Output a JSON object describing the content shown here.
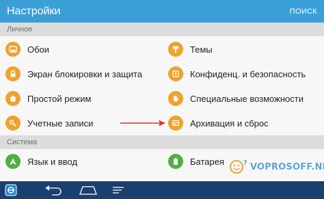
{
  "header": {
    "title": "Настройки",
    "search_label": "ПОИСК"
  },
  "sections": [
    {
      "title": "Личное",
      "items": [
        {
          "label": "Обои",
          "icon": "image-icon",
          "color": "#f0a22c"
        },
        {
          "label": "Темы",
          "icon": "brush-icon",
          "color": "#f0a22c"
        },
        {
          "label": "Экран блокировки и защита",
          "icon": "lock-icon",
          "color": "#f0a22c"
        },
        {
          "label": "Конфиденц. и безопасность",
          "icon": "shield-icon",
          "color": "#f0a22c"
        },
        {
          "label": "Простой режим",
          "icon": "home-icon",
          "color": "#f0a22c"
        },
        {
          "label": "Специальные возможности",
          "icon": "hand-icon",
          "color": "#f0a22c"
        },
        {
          "label": "Учетные записи",
          "icon": "key-icon",
          "color": "#f0a22c"
        },
        {
          "label": "Архивация и сброс",
          "icon": "backup-icon",
          "color": "#f0a22c"
        }
      ]
    },
    {
      "title": "Система",
      "items": [
        {
          "label": "Язык и ввод",
          "icon": "language-icon",
          "color": "#52ad45"
        },
        {
          "label": "Батарея",
          "icon": "battery-icon",
          "color": "#52ad45"
        }
      ]
    }
  ],
  "watermark": {
    "text": "VOPROSOFF.NET"
  },
  "accent_color": "#3a9fd6",
  "navbar_color": "#1b3f6e"
}
